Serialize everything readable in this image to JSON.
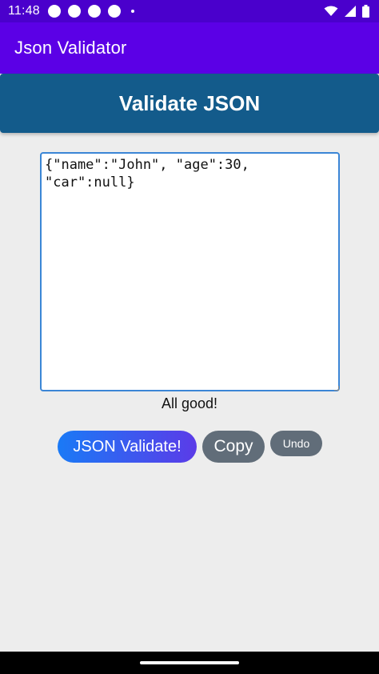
{
  "status_bar": {
    "time": "11:48",
    "icons": [
      "circle-icon",
      "circle-icon",
      "circle-icon",
      "circle-icon",
      "dot-icon",
      "wifi-icon",
      "signal-icon",
      "battery-icon"
    ]
  },
  "app_bar": {
    "title": "Json Validator"
  },
  "header": {
    "title": "Validate JSON"
  },
  "editor": {
    "value": "{\"name\":\"John\", \"age\":30,\n\"car\":null}"
  },
  "message": "All good!",
  "buttons": {
    "validate": "JSON Validate!",
    "copy": "Copy",
    "undo": "Undo"
  },
  "colors": {
    "status_bar": "#4a00cc",
    "app_bar": "#5b00e6",
    "header": "#135b8b",
    "background": "#ededed",
    "editor_border": "#3b86d6",
    "button_gray": "#616d79",
    "gradient_start": "#1a7af6",
    "gradient_end": "#5b3be8"
  }
}
